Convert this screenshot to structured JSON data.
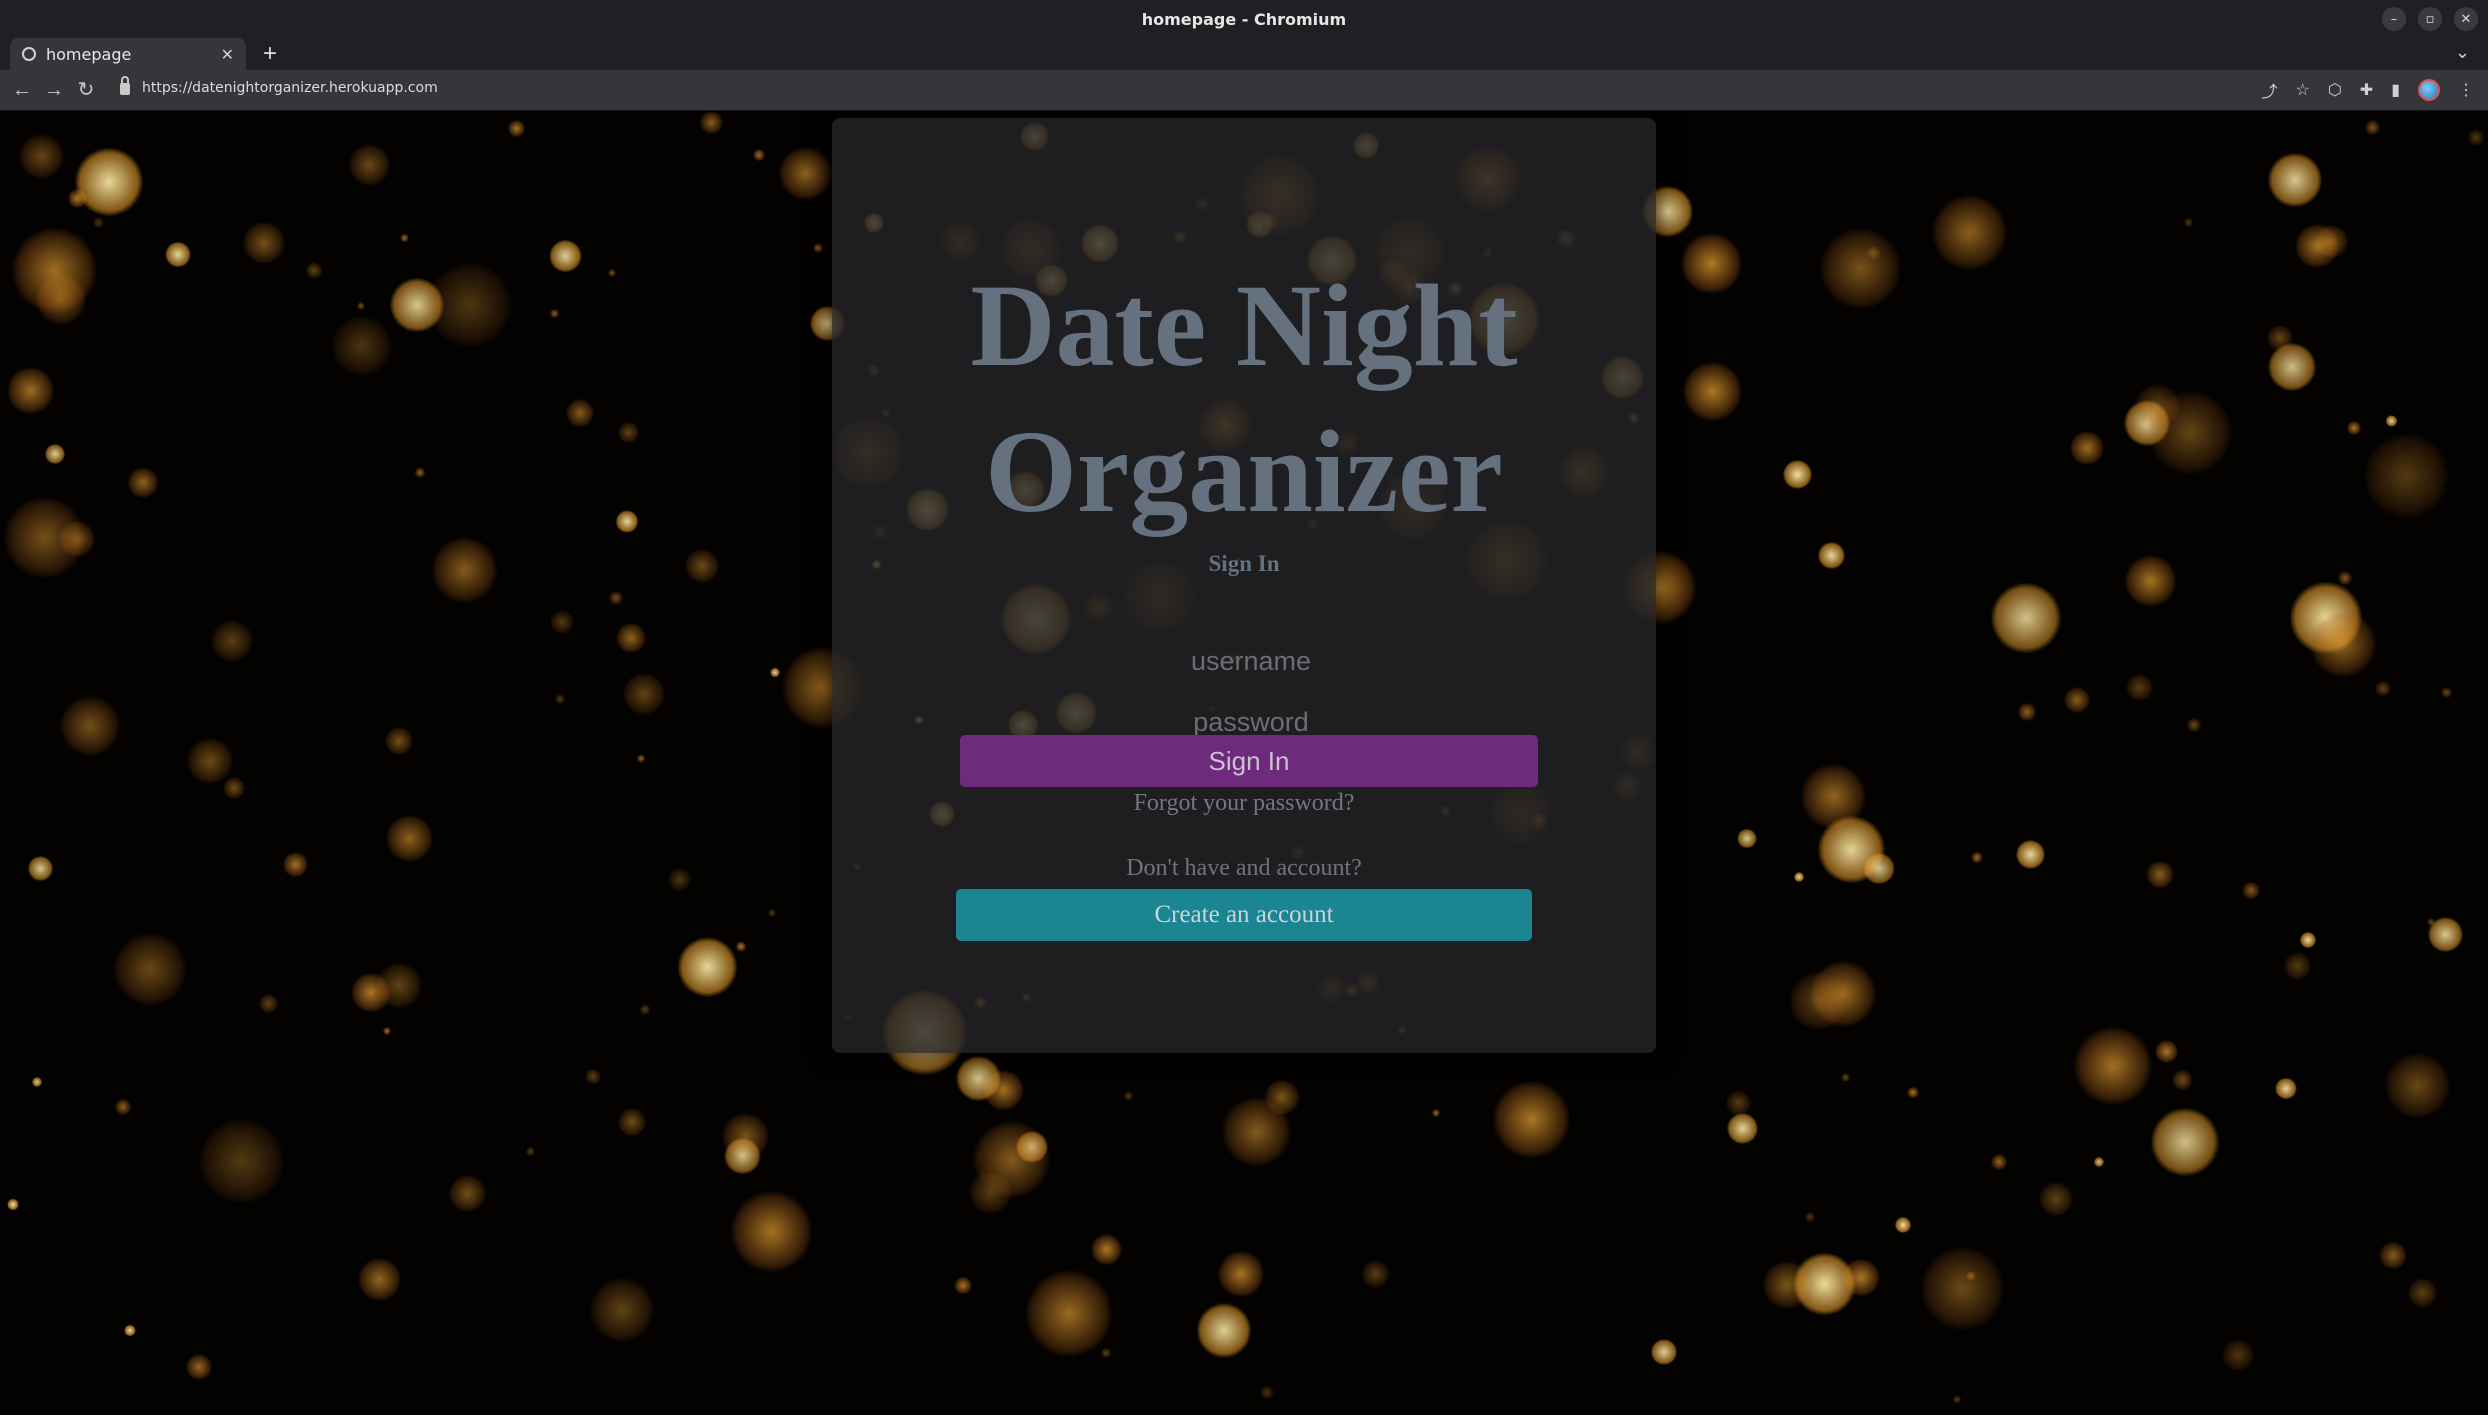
{
  "window": {
    "title": "homepage - Chromium",
    "controls": [
      "–",
      "▫",
      "✕"
    ]
  },
  "tabs": [
    {
      "title": "homepage",
      "close": "✕"
    }
  ],
  "newtab_label": "+",
  "tab_menu_label": "⌄",
  "toolbar": {
    "back": "←",
    "forward": "→",
    "reload": "↻",
    "url": "https://datenightorganizer.herokuapp.com",
    "share": "⤴",
    "bookmark": "☆",
    "extension": "⬡",
    "puzzle": "✚",
    "sidepanel": "▮",
    "menu": "⋮"
  },
  "login": {
    "title_line1": "Date Night",
    "title_line2": "Organizer",
    "heading": "Sign In",
    "username_placeholder": "username",
    "password_placeholder": "password",
    "signin_button": "Sign In",
    "forgot_link": "Forgot your password?",
    "no_account_text": "Don't have and account?",
    "create_button": "Create an account"
  },
  "colors": {
    "signin_button": "#6e2a7c",
    "create_button": "#1b8591",
    "title_text": "#66717f",
    "bokeh": "#f2a425"
  }
}
